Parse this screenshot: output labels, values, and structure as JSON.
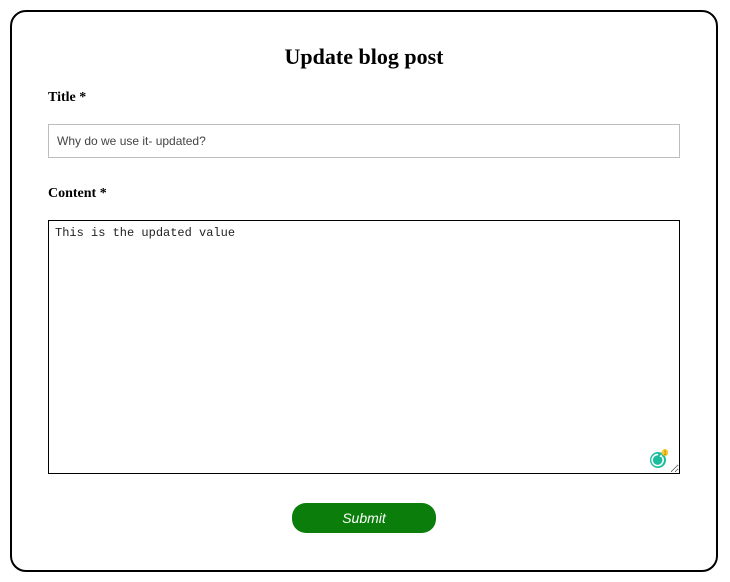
{
  "form": {
    "heading": "Update blog post",
    "title_label": "Title *",
    "title_value": "Why do we use it- updated?",
    "content_label": "Content *",
    "content_value": "This is the updated value",
    "submit_label": "Submit"
  },
  "grammarly": {
    "badge_count": "1"
  }
}
